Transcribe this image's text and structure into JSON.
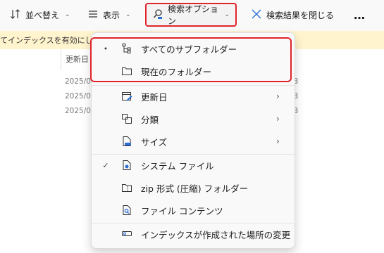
{
  "toolbar": {
    "sort_label": "並べ替え",
    "view_label": "表示",
    "search_options_label": "検索オプション",
    "close_results_label": "検索結果を閉じる",
    "more_label": "…"
  },
  "banner": {
    "text": "てインデックスを有効にしてく"
  },
  "file_list": {
    "column_header": "更新日",
    "rows": [
      {
        "date": "2025/0",
        "size": "B"
      },
      {
        "date": "2025/0",
        "size": "B"
      },
      {
        "date": "2025/0",
        "size": "B"
      }
    ]
  },
  "menu": {
    "items": [
      {
        "label": "すべてのサブフォルダー",
        "mark": "•",
        "icon": "subfolder-tree-icon"
      },
      {
        "label": "現在のフォルダー",
        "mark": "",
        "icon": "folder-icon"
      },
      {
        "label": "更新日",
        "mark": "",
        "icon": "calendar-edit-icon",
        "submenu": true
      },
      {
        "label": "分類",
        "mark": "",
        "icon": "shapes-icon",
        "submenu": true
      },
      {
        "label": "サイズ",
        "mark": "",
        "icon": "file-size-icon",
        "submenu": true
      },
      {
        "label": "システム ファイル",
        "mark": "✓",
        "icon": "system-file-icon"
      },
      {
        "label": "zip 形式 (圧縮) フォルダー",
        "mark": "",
        "icon": "zip-folder-icon"
      },
      {
        "label": "ファイル コンテンツ",
        "mark": "",
        "icon": "file-search-icon"
      },
      {
        "label": "インデックスが作成された場所の変更",
        "mark": "",
        "icon": "index-location-icon"
      }
    ],
    "submenu_arrow": "›"
  }
}
